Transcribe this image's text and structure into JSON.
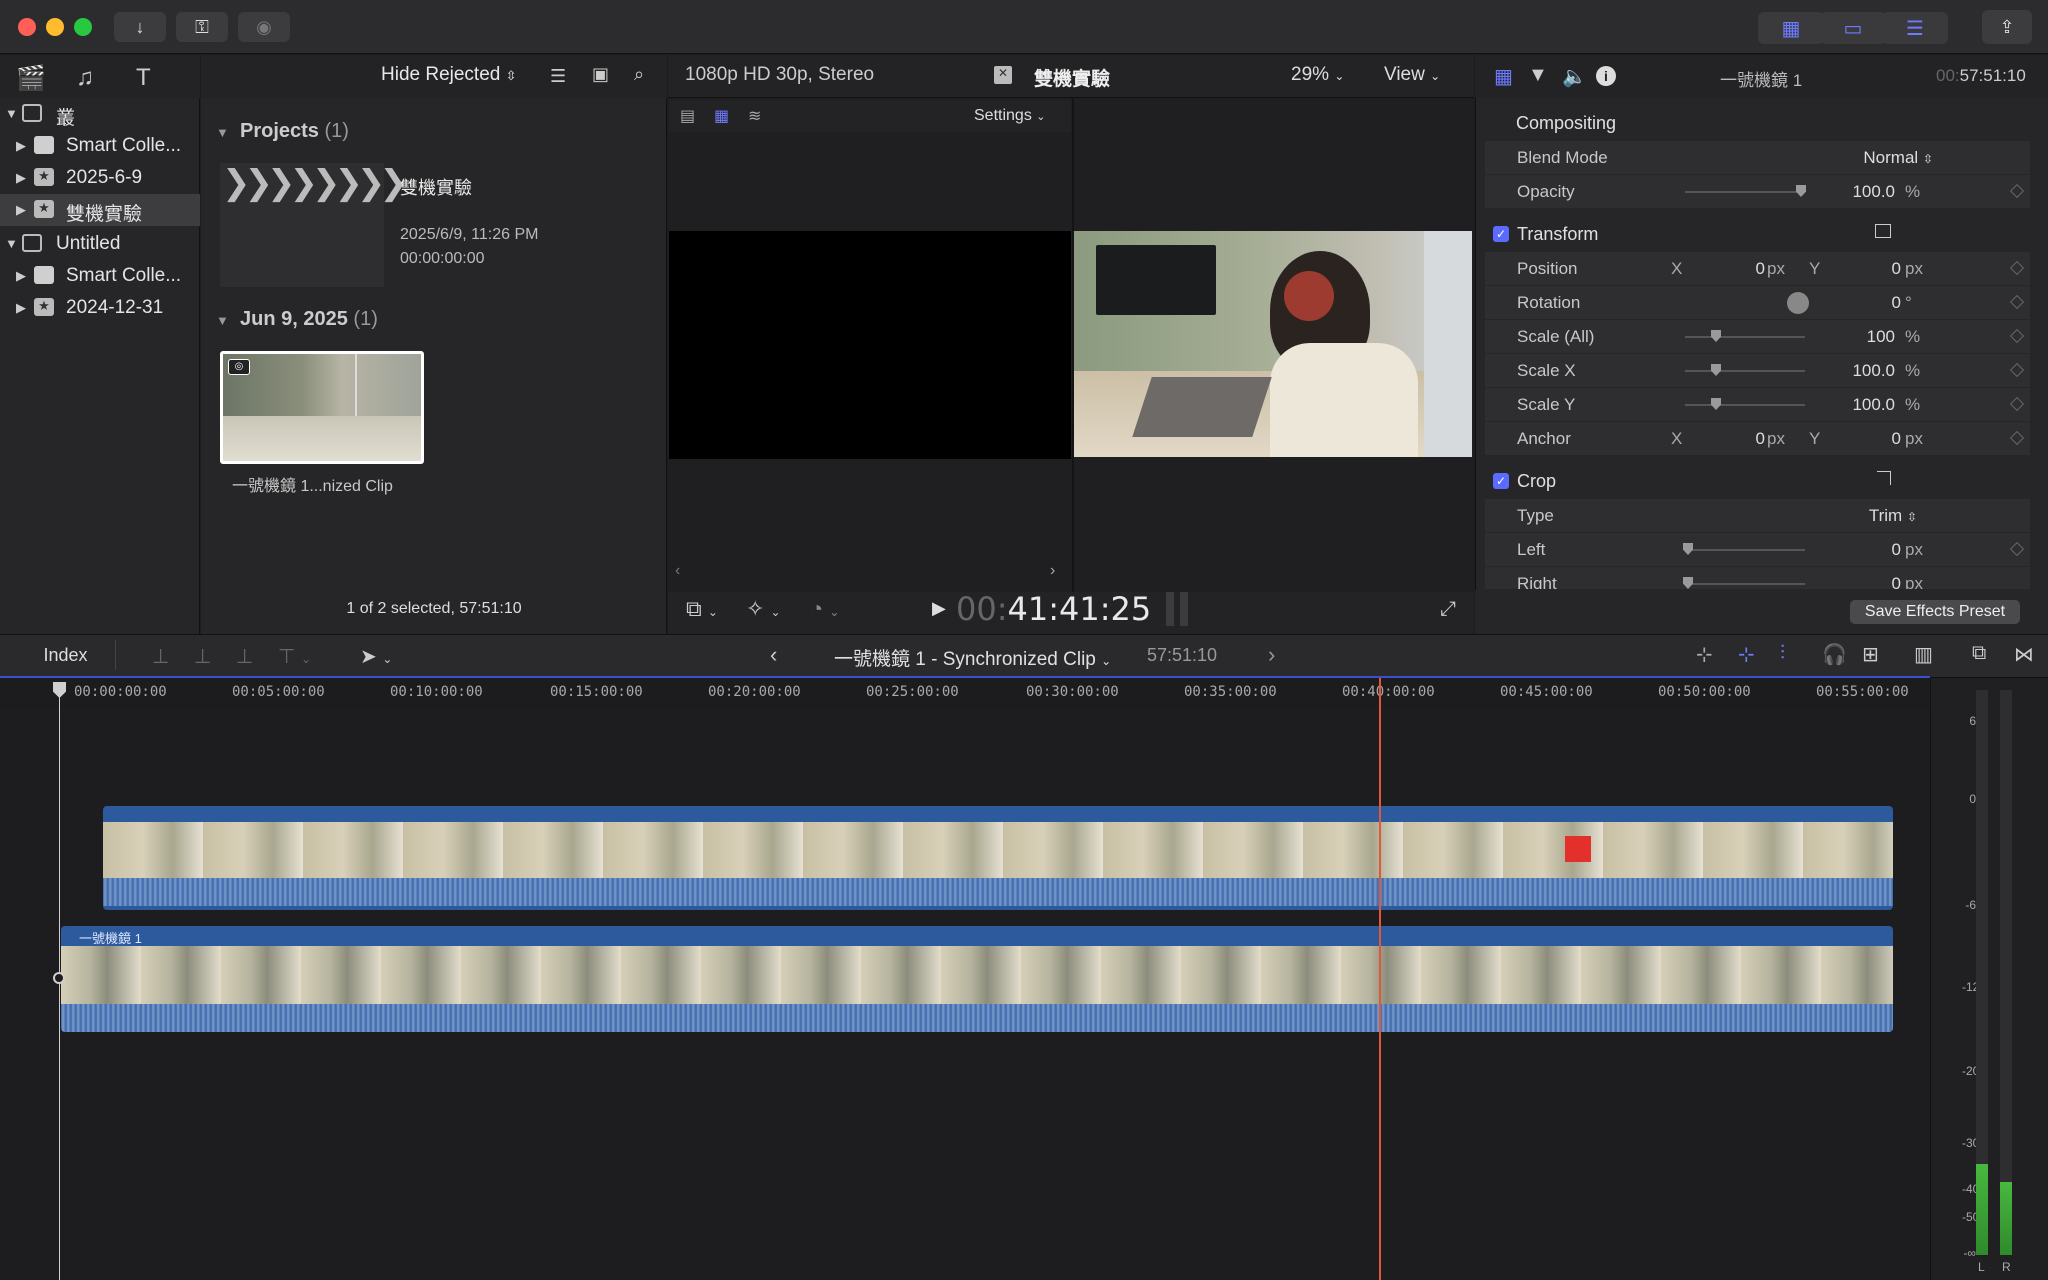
{
  "browser": {
    "filter_label": "Hide Rejected",
    "projects_header": "Projects",
    "projects_count": "(1)",
    "project": {
      "name": "雙機實驗",
      "date": "2025/6/9, 11:26 PM",
      "timecode": "00:00:00:00"
    },
    "date_header": "Jun 9, 2025",
    "date_count": "(1)",
    "clip_name": "一號機鏡 1...nized Clip",
    "status": "1 of 2 selected, 57:51:10"
  },
  "sidebar": {
    "items": [
      {
        "label": "叢",
        "type": "library"
      },
      {
        "label": "Smart Colle...",
        "type": "folder"
      },
      {
        "label": "2025-6-9",
        "type": "event"
      },
      {
        "label": "雙機實驗",
        "type": "event"
      },
      {
        "label": "Untitled",
        "type": "library"
      },
      {
        "label": "Smart Colle...",
        "type": "folder"
      },
      {
        "label": "2024-12-31",
        "type": "event"
      }
    ]
  },
  "viewer": {
    "format": "1080p HD 30p, Stereo",
    "title": "雙機實驗",
    "zoom": "29%",
    "view_label": "View",
    "settings_label": "Settings",
    "timecode_dim": "00:",
    "timecode": "41:41:25"
  },
  "inspector": {
    "clip_name": "一號機鏡 1",
    "duration_dim": "00:",
    "duration": "57:51:10",
    "compositing": "Compositing",
    "blend_mode_label": "Blend Mode",
    "blend_mode_value": "Normal",
    "opacity_label": "Opacity",
    "opacity_value": "100.0",
    "transform": "Transform",
    "position_label": "Position",
    "rotation_label": "Rotation",
    "scale_all_label": "Scale (All)",
    "scale_all_value": "100",
    "scale_x_label": "Scale X",
    "scale_x_value": "100.0",
    "scale_y_label": "Scale Y",
    "scale_y_value": "100.0",
    "anchor_label": "Anchor",
    "crop": "Crop",
    "type_label": "Type",
    "type_value": "Trim",
    "left_label": "Left",
    "right_label": "Right",
    "zero": "0",
    "x_axis": "X",
    "y_axis": "Y",
    "unit_px": "px",
    "unit_pct": "%",
    "unit_deg": "°",
    "save_preset": "Save Effects Preset"
  },
  "timeline": {
    "index_label": "Index",
    "clip_title": "一號機鏡 1 - Synchronized Clip",
    "duration": "57:51:10",
    "lower_clip_label": "一號機鏡 1",
    "ruler": [
      "00:00:00:00",
      "00:05:00:00",
      "00:10:00:00",
      "00:15:00:00",
      "00:20:00:00",
      "00:25:00:00",
      "00:30:00:00",
      "00:35:00:00",
      "00:40:00:00",
      "00:45:00:00",
      "00:50:00:00",
      "00:55:00:00"
    ],
    "playhead_timecode": "41:41:25"
  },
  "meters": {
    "scale": [
      "6",
      "0",
      "-6",
      "-12",
      "-20",
      "-30",
      "-40",
      "-50",
      "-∞"
    ],
    "left_label": "L",
    "right_label": "R"
  },
  "colors": {
    "accent": "#6e7bff",
    "playhead": "#e0583a",
    "clip_blue": "#2d5a9a"
  }
}
